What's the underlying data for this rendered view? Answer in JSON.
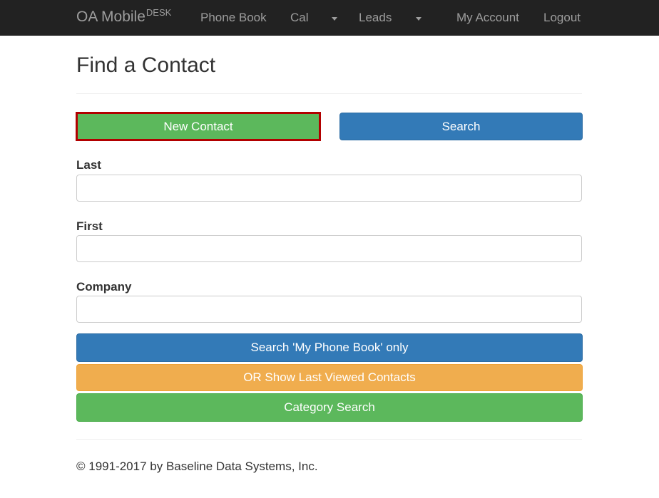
{
  "navbar": {
    "brand_main": "OA Mobile",
    "brand_sup": "DESK",
    "items": [
      {
        "label": "Phone Book"
      },
      {
        "label": "Cal"
      },
      {
        "label": "Leads"
      },
      {
        "label": "My Account"
      },
      {
        "label": "Logout"
      }
    ]
  },
  "main": {
    "title": "Find a Contact",
    "new_contact_label": "New Contact",
    "search_label": "Search",
    "fields": [
      {
        "label": "Last",
        "value": ""
      },
      {
        "label": "First",
        "value": ""
      },
      {
        "label": "Company",
        "value": ""
      }
    ],
    "search_my_phonebook_label": "Search 'My Phone Book' only",
    "last_viewed_label": "OR Show Last Viewed Contacts",
    "category_search_label": "Category Search"
  },
  "footer": {
    "copyright": "© 1991-2017 by Baseline Data Systems, Inc."
  },
  "colors": {
    "navbar_bg": "#222222",
    "green": "#5cb85c",
    "blue": "#337ab7",
    "orange": "#f0ad4e",
    "highlight_border": "#b20000"
  }
}
